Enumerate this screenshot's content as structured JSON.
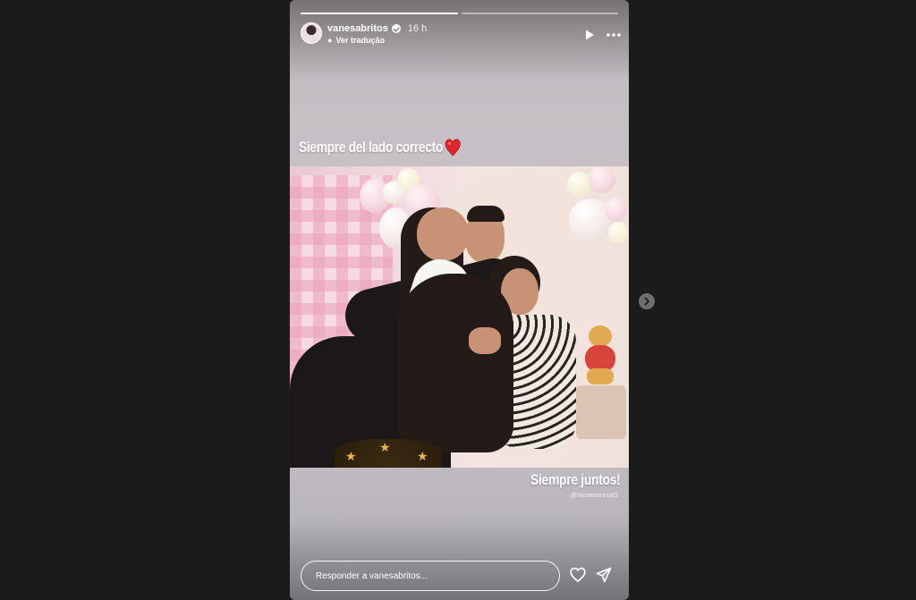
{
  "story": {
    "progress": [
      1.0,
      0.0
    ],
    "user": {
      "username": "vanesabritos",
      "time_ago": "16 h",
      "translate_label": "Ver tradução"
    },
    "caption_top": "Siempre del lado correcto",
    "caption_bottom": "Siempre juntos!",
    "credit": "@nicoleteresaO",
    "reply_placeholder": "Responder a vanesabritos...",
    "icons": {
      "play": "play-icon",
      "more": "more-icon",
      "verified": "verified-badge-icon",
      "heart_emoji": "red-heart-emoji",
      "like": "heart-outline-icon",
      "share": "send-icon",
      "next": "chevron-right-icon"
    }
  },
  "colors": {
    "background": "#1b1b1b",
    "text": "#ffffff",
    "emoji_heart": "#e0242f"
  }
}
